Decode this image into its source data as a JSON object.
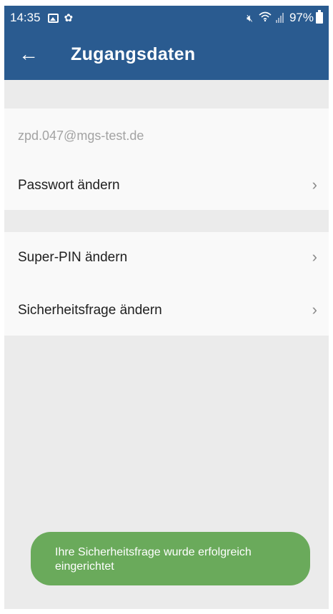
{
  "status_bar": {
    "time": "14:35",
    "battery_percent": "97%",
    "icons": [
      "image-icon",
      "app-notification-icon",
      "mute-icon",
      "wifi-icon",
      "signal-icon",
      "battery-icon"
    ]
  },
  "toolbar": {
    "back_icon": "arrow-left-icon",
    "title": "Zugangsdaten"
  },
  "account": {
    "email": "zpd.047@mgs-test.de"
  },
  "settings": {
    "change_password": "Passwort ändern",
    "change_super_pin": "Super-PIN ändern",
    "change_security_question": "Sicherheitsfrage ändern"
  },
  "toast": {
    "message": "Ihre Sicherheitsfrage wurde erfolgreich eingerichtet"
  },
  "colors": {
    "primary": "#2a5b90",
    "toast_green": "#6aaa5b",
    "background": "#ebebeb",
    "card": "#f9f9f9"
  }
}
